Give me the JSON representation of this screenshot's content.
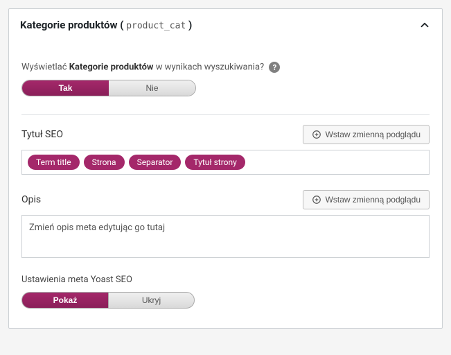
{
  "header": {
    "title_prefix": "Kategorie produktów",
    "title_paren_open": "(",
    "title_code": "product_cat",
    "title_paren_close": ")"
  },
  "show_in_search": {
    "question_prefix": "Wyświetlać ",
    "question_bold": "Kategorie produktów",
    "question_suffix": " w wynikach wyszukiwania?",
    "help_char": "?",
    "yes": "Tak",
    "no": "Nie"
  },
  "seo_title": {
    "label": "Tytuł SEO",
    "insert_label": "Wstaw zmienną podglądu",
    "pills": [
      "Term title",
      "Strona",
      "Separator",
      "Tytuł strony"
    ]
  },
  "description": {
    "label": "Opis",
    "insert_label": "Wstaw zmienną podglądu",
    "placeholder": "Zmień opis meta edytując go tutaj"
  },
  "meta_settings": {
    "label": "Ustawienia meta Yoast SEO",
    "show": "Pokaż",
    "hide": "Ukryj"
  },
  "colors": {
    "accent": "#a4286a"
  }
}
